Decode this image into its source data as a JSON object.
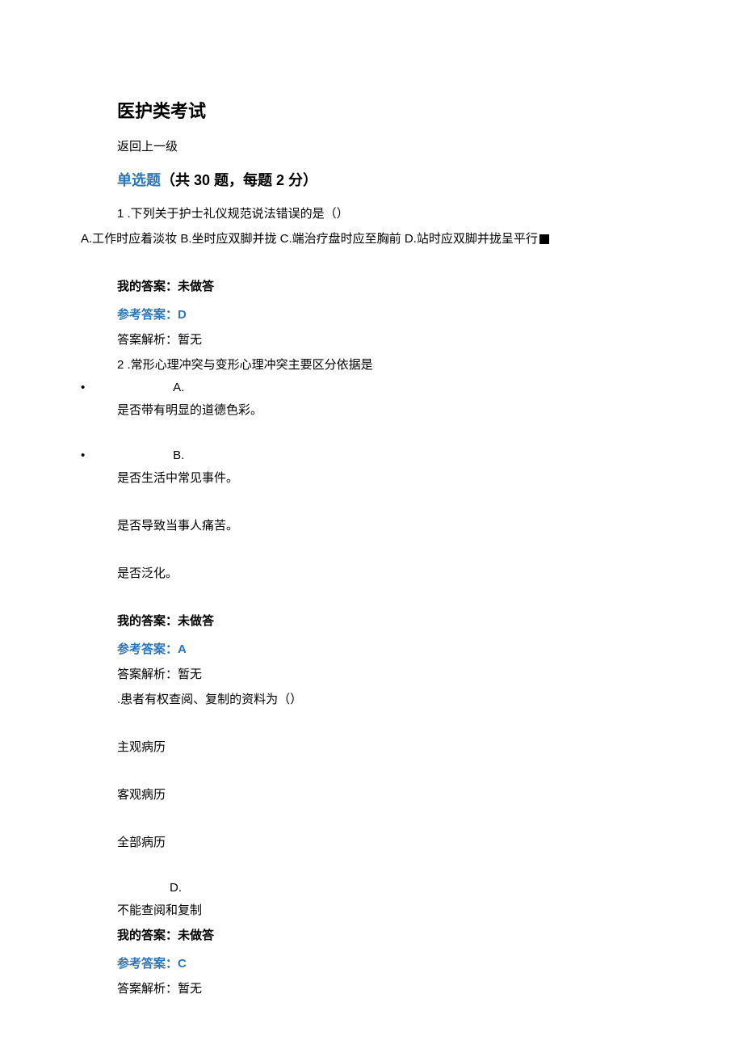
{
  "title": "医护类考试",
  "back_link": "返回上一级",
  "section": {
    "label": "单选题",
    "count_text": "（共 30 题，每题 2 分）"
  },
  "q1": {
    "num": "1",
    "stem": ".下列关于护士礼仪规范说法错误的是（）",
    "opts_line": "A.工作时应着淡妆 B.坐时应双脚并拢 C.端治疗盘时应至胸前 D.站时应双脚并拢呈平行",
    "my_answer_label": "我的答案：未做答",
    "ref_label": "参考答案：",
    "ref_value": "D",
    "explain": "答案解析：暂无"
  },
  "q2": {
    "num": "2",
    "stem": ".常形心理冲突与变形心理冲突主要区分依据是",
    "optA_label": "A.",
    "optA_text": "是否带有明显的道德色彩。",
    "optB_label": "B.",
    "optB_text": "是否生活中常见事件。",
    "optC_text": "是否导致当事人痛苦。",
    "optD_text": "是否泛化。",
    "my_answer_label": "我的答案：未做答",
    "ref_label": "参考答案：",
    "ref_value": "A",
    "explain": "答案解析：暂无"
  },
  "q3": {
    "stem": ".患者有权查阅、复制的资料为（）",
    "optA_text": "主观病历",
    "optB_text": "客观病历",
    "optC_text": "全部病历",
    "optD_label": "D.",
    "optD_text": "不能查阅和复制",
    "my_answer_label": "我的答案：未做答",
    "ref_label": "参考答案：",
    "ref_value": "C",
    "explain": "答案解析：暂无"
  }
}
